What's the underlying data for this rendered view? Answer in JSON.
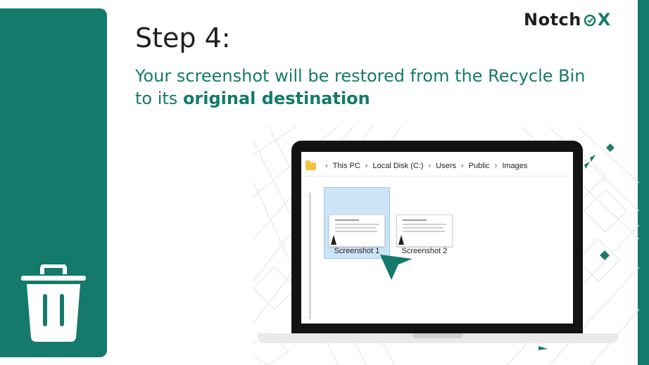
{
  "brand": {
    "logo_prefix": "Notch",
    "logo_suffix": "X",
    "accent": "#147a6c"
  },
  "slide": {
    "title": "Step 4:",
    "subtitle_plain": "Your screenshot will be restored from the Recycle Bin to its ",
    "subtitle_bold": "original destination"
  },
  "explorer": {
    "breadcrumb": [
      "This PC",
      "Local Disk (C:)",
      "Users",
      "Public",
      "Images"
    ],
    "files": [
      {
        "name": "Screenshot 1",
        "selected": true
      },
      {
        "name": "Screenshot 2",
        "selected": false
      }
    ]
  },
  "icons": {
    "side": "trash-icon",
    "folder": "folder-icon",
    "pointer": "cursor-arrow-icon"
  }
}
